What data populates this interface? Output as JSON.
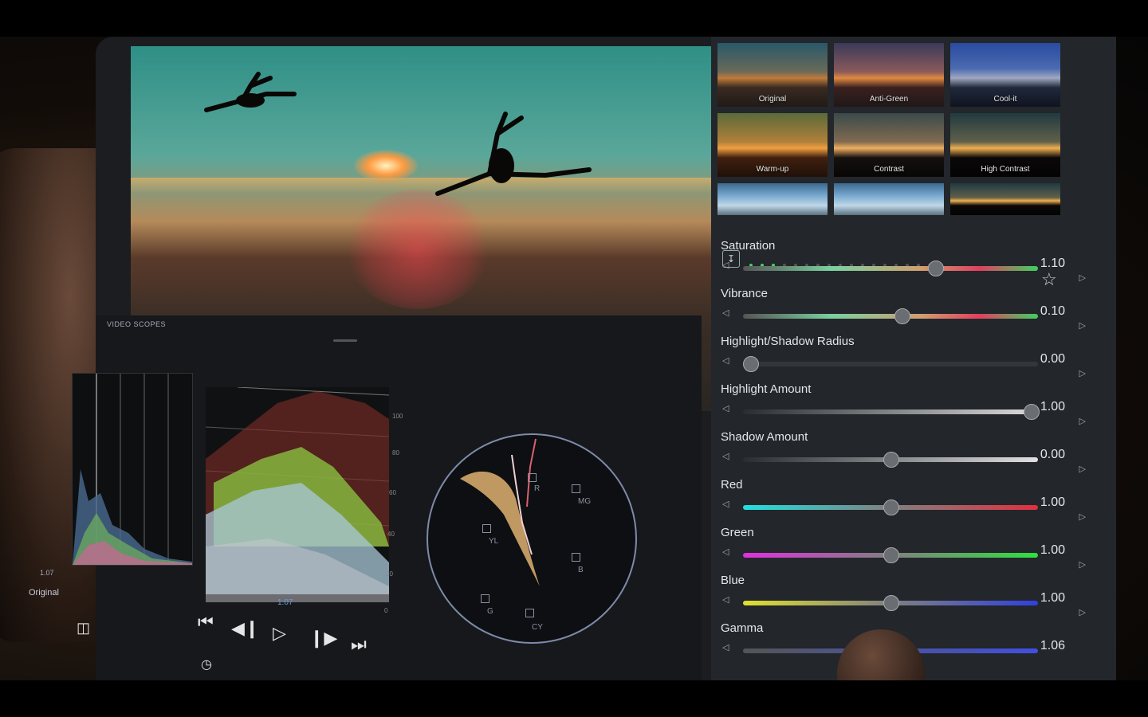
{
  "scopes": {
    "title": "VIDEO SCOPES",
    "histogram_value": "1.07",
    "original_label": "Original",
    "waveform_ticks": [
      "100",
      "80",
      "60",
      "40",
      "20",
      "0"
    ],
    "vectorscope_labels": {
      "r": "R",
      "mg": "MG",
      "yl": "YL",
      "b": "B",
      "g": "G",
      "cy": "CY"
    }
  },
  "transport": {
    "timecode": "1.07"
  },
  "presets": [
    {
      "label": "Original"
    },
    {
      "label": "Anti-Green"
    },
    {
      "label": "Cool-it"
    },
    {
      "label": "Warm-up"
    },
    {
      "label": "Contrast"
    },
    {
      "label": "High Contrast"
    }
  ],
  "controls": [
    {
      "label": "Saturation",
      "value": "1.10",
      "level": 0.66
    },
    {
      "label": "Vibrance",
      "value": "0.10",
      "level": 0.54
    },
    {
      "label": "Highlight/Shadow Radius",
      "value": "0.00",
      "level": 0.0
    },
    {
      "label": "Highlight Amount",
      "value": "1.00",
      "level": 1.0
    },
    {
      "label": "Shadow Amount",
      "value": "0.00",
      "level": 0.5
    },
    {
      "label": "Red",
      "value": "1.00",
      "level": 0.5
    },
    {
      "label": "Green",
      "value": "1.00",
      "level": 0.5
    },
    {
      "label": "Blue",
      "value": "1.00",
      "level": 0.5
    },
    {
      "label": "Gamma",
      "value": "1.06",
      "level": 0.52
    }
  ],
  "colors": {
    "accent_green": "#4cd06a",
    "timecode_blue": "#6a9ad8"
  }
}
